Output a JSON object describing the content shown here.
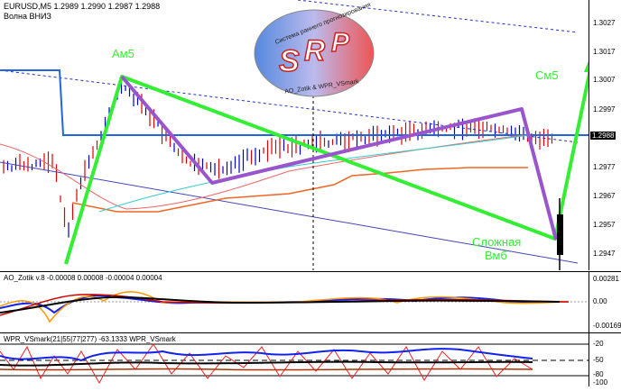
{
  "header": {
    "symbol_line": "EURUSD,M5  1.2989 1.2990 1.2987 1.2988",
    "subtitle": "Волна ВНИЗ"
  },
  "main_axis": {
    "labels": [
      "1.3027",
      "1.3017",
      "1.3007",
      "1.2997",
      "1.2988",
      "1.2977",
      "1.2967",
      "1.2957",
      "1.2947"
    ],
    "current": "1.2988"
  },
  "waves": {
    "a": "Ам5",
    "c": "См5",
    "complex": "Сложная",
    "b": "Вмб"
  },
  "logo": {
    "letters": "SRP",
    "top_text": "Система раннего прогнозирования",
    "bottom_text": "AO_Zotik & WPR_VSmark"
  },
  "ao_panel": {
    "title": "AO_Zotik v.8 -0.00008 0.00008 -0.00004 0.00004",
    "axis": [
      "0.00281",
      "0.00",
      "-0.00169"
    ]
  },
  "wpr_panel": {
    "title": "WPR_VSmark(21|55|77|277) -63.1333 WPR_VSmark",
    "axis": [
      "-20",
      "-50",
      "-80",
      "-100"
    ]
  },
  "colors": {
    "wave_green": "#33ee33",
    "wave_purple": "#9955cc",
    "bull": "#0000cc",
    "bear": "#dd0000"
  }
}
